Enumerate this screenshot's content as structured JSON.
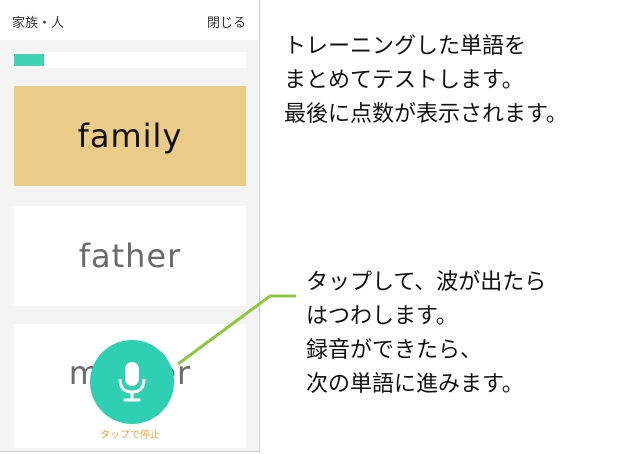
{
  "header": {
    "title": "家族・人",
    "close_label": "閉じる"
  },
  "progress": {
    "value": 0.13
  },
  "cards": {
    "current_word": "family",
    "option_1": "father",
    "option_2": "mother"
  },
  "mic": {
    "label": "タップで停止"
  },
  "annotations": {
    "top": "トレーニングした単語を\nまとめてテストします。\n最後に点数が表示されます。",
    "bottom": "タップして、波が出たら\nはつわします。\n録音ができたら、\n次の単語に進みます。"
  },
  "colors": {
    "accent": "#2ecfb2",
    "active_card": "#eacb88",
    "connector": "#8dc63f",
    "mic_label": "#f0a640"
  },
  "icons": {
    "mic": "microphone-icon"
  }
}
